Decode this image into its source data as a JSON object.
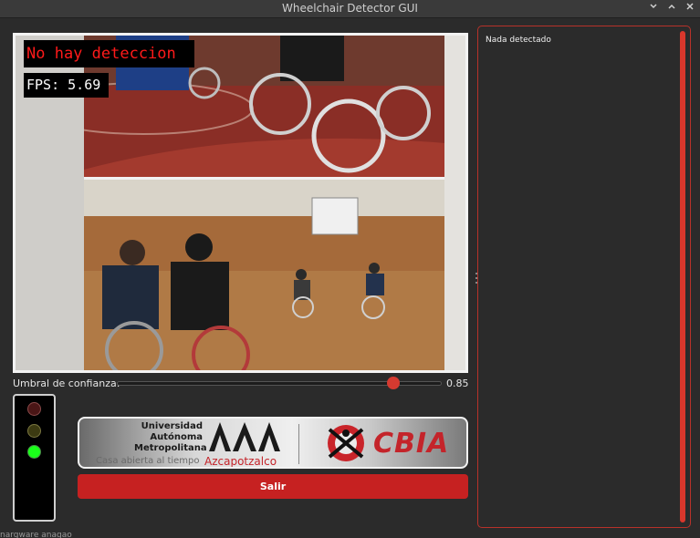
{
  "window": {
    "title": "Wheelchair Detector GUI",
    "controls": [
      "chevron-down-icon",
      "chevron-up-icon",
      "close-icon"
    ]
  },
  "camera": {
    "detection_text": "No hay deteccion",
    "fps_text": "FPS: 5.69"
  },
  "threshold": {
    "label": "Umbral de confianza:",
    "value": 0.85,
    "value_text": "0.85"
  },
  "traffic_light": {
    "red": "off",
    "yellow": "off",
    "green": "on"
  },
  "logos": {
    "uam_lines": [
      "Universidad",
      "Autónoma",
      "Metropolitana"
    ],
    "uam_motto": "Casa abierta al tiempo",
    "uam_campus": "Azcapotzalco",
    "cbia": "CBIA"
  },
  "quit_button": {
    "label": "Salir"
  },
  "results": {
    "text": "Nada detectado"
  },
  "status": {
    "text": "nargware anagao"
  },
  "colors": {
    "accent_red": "#c62121",
    "background": "#2b2b2b",
    "light_green": "#1aff1a"
  }
}
